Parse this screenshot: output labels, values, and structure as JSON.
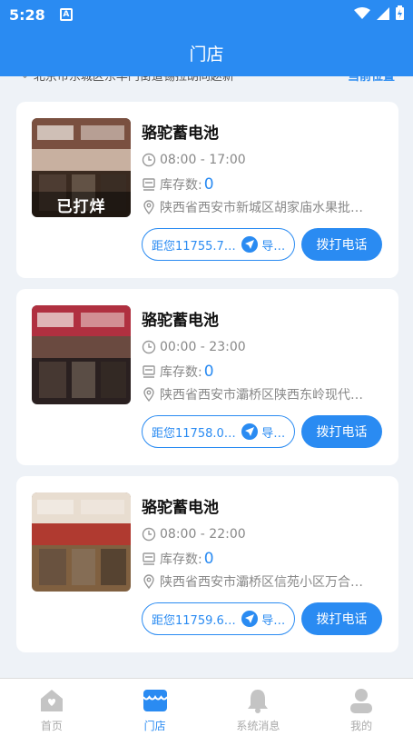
{
  "status_bar": {
    "time": "5:28",
    "badge": "A",
    "icons": [
      "wifi-icon",
      "signal-icon",
      "battery-icon"
    ]
  },
  "header": {
    "title": "门店"
  },
  "location_bar": {
    "address": "北京市东城区东华门街道锡拉胡同赵新",
    "current_label": "当前位置"
  },
  "stores": [
    {
      "name": "骆驼蓄电池",
      "photo_overlay": "已打烊",
      "hours": "08:00 - 17:00",
      "stock_label": "库存数:",
      "stock_value": "0",
      "address": "陕西省西安市新城区胡家庙水果批…",
      "distance": "距您11755.7…",
      "nav_label": "导…",
      "call_label": "拨打电话",
      "photo_colors": [
        "#7a5040",
        "#c8b0a0",
        "#3a2a20"
      ]
    },
    {
      "name": "骆驼蓄电池",
      "photo_overlay": "",
      "hours": "00:00 - 23:00",
      "stock_label": "库存数:",
      "stock_value": "0",
      "address": "陕西省西安市灞桥区陕西东岭现代…",
      "distance": "距您11758.0…",
      "nav_label": "导…",
      "call_label": "拨打电话",
      "photo_colors": [
        "#b03040",
        "#6a4a40",
        "#2a2020"
      ]
    },
    {
      "name": "骆驼蓄电池",
      "photo_overlay": "",
      "hours": "08:00 - 22:00",
      "stock_label": "库存数:",
      "stock_value": "0",
      "address": "陕西省西安市灞桥区信苑小区万合…",
      "distance": "距您11759.6…",
      "nav_label": "导…",
      "call_label": "拨打电话",
      "photo_colors": [
        "#e8ddd0",
        "#b03a30",
        "#806040"
      ]
    }
  ],
  "tabs": [
    {
      "label": "首页",
      "icon": "home-icon",
      "active": false
    },
    {
      "label": "门店",
      "icon": "store-icon",
      "active": true
    },
    {
      "label": "系统消息",
      "icon": "bell-icon",
      "active": false
    },
    {
      "label": "我的",
      "icon": "user-icon",
      "active": false
    }
  ],
  "colors": {
    "primary": "#2a8bf2",
    "background": "#eef2f7"
  }
}
